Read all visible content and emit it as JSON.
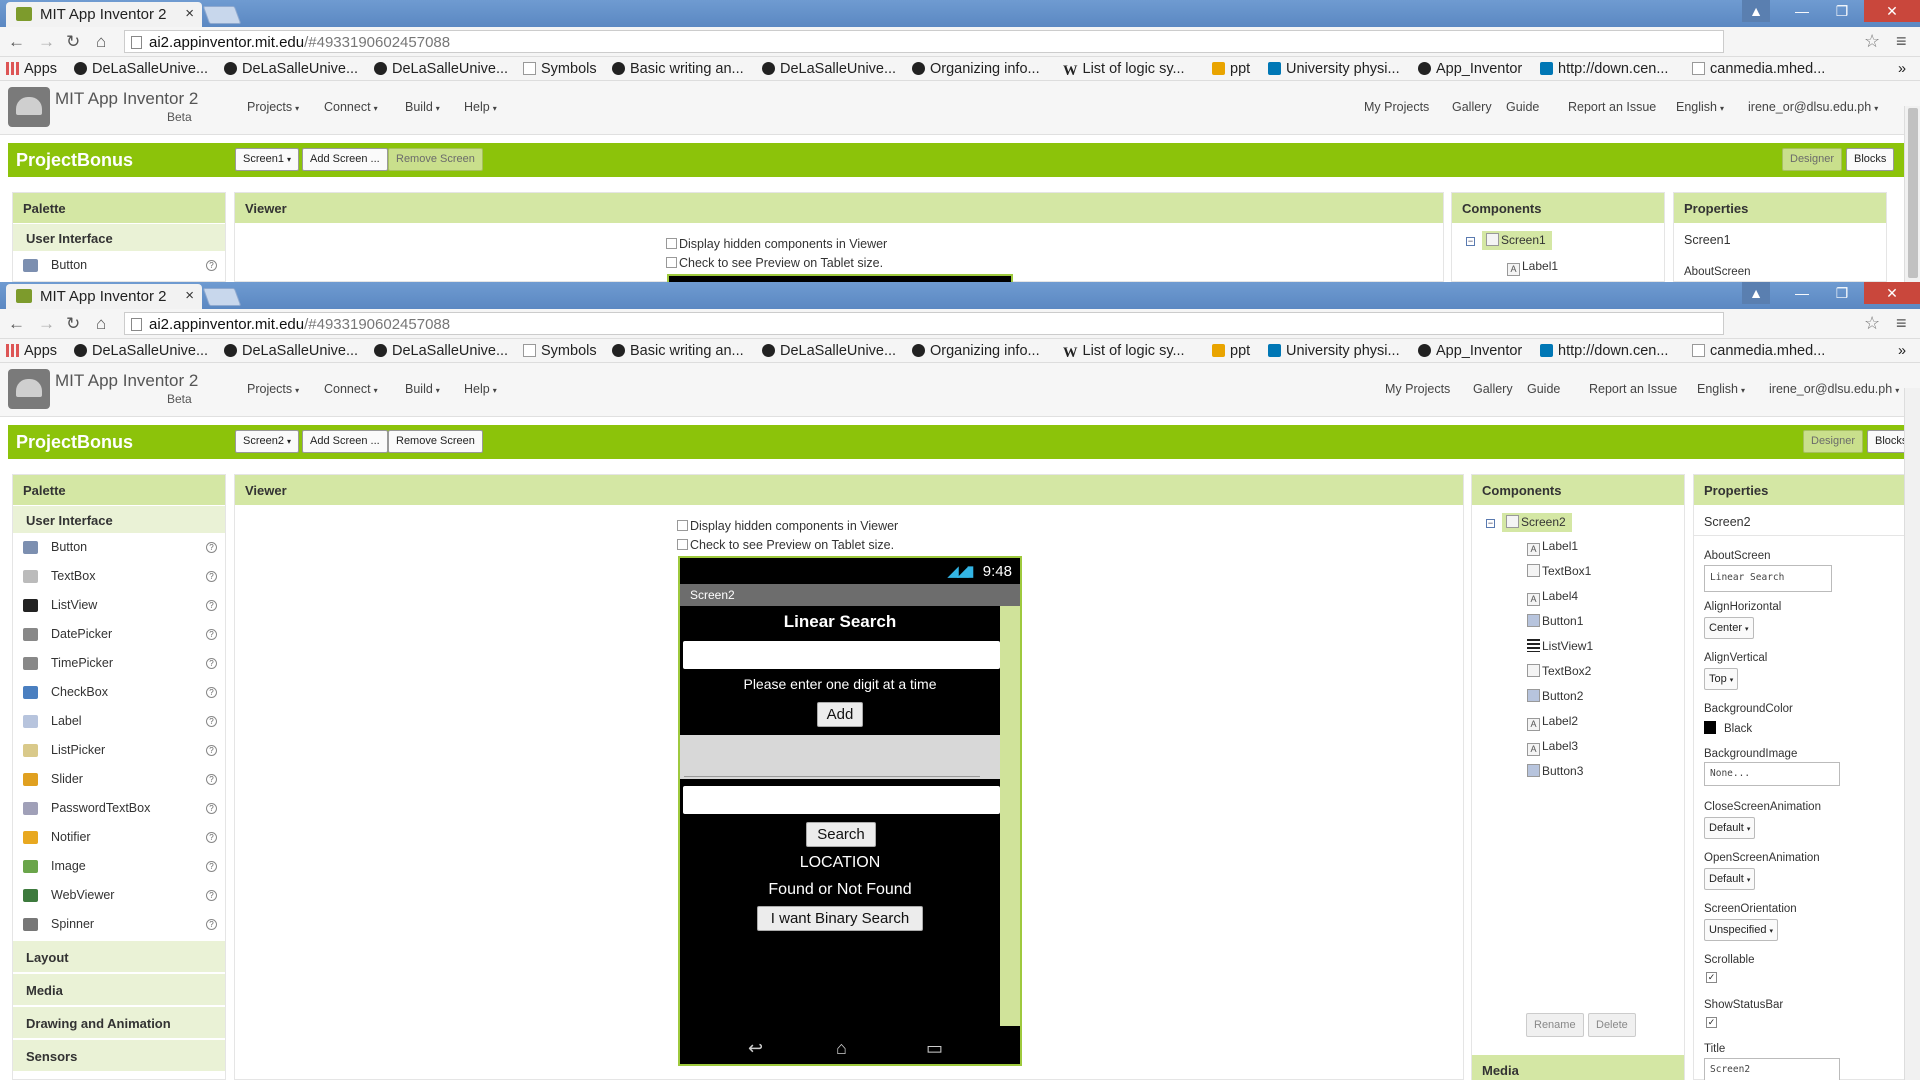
{
  "browser": {
    "tab_title": "MIT App Inventor 2",
    "tab_close": "×",
    "url_host": "ai2.appinventor.mit.edu",
    "url_path": "/#4933190602457088",
    "win_min": "—",
    "win_max": "❐",
    "win_close": "✕",
    "nav_back": "←",
    "nav_forward": "→",
    "nav_reload": "↻",
    "nav_home": "⌂",
    "star": "☆",
    "menu": "≡",
    "user_glyph": "▲",
    "more": "»"
  },
  "bookmarks": [
    {
      "label": "Apps",
      "icon": "apps-icon"
    },
    {
      "label": "DeLaSalleUnive...",
      "icon": "github-icon"
    },
    {
      "label": "DeLaSalleUnive...",
      "icon": "github-icon"
    },
    {
      "label": "DeLaSalleUnive...",
      "icon": "github-icon"
    },
    {
      "label": "Symbols",
      "icon": "symbols-icon"
    },
    {
      "label": "Basic writing an...",
      "icon": "github-icon"
    },
    {
      "label": "DeLaSalleUnive...",
      "icon": "github-icon"
    },
    {
      "label": "Organizing info...",
      "icon": "github-icon"
    },
    {
      "label": "List of logic sy...",
      "icon": "wikipedia-icon"
    },
    {
      "label": "ppt",
      "icon": "folder-icon"
    },
    {
      "label": "University physi...",
      "icon": "linkedin-icon"
    },
    {
      "label": "App_Inventor",
      "icon": "github-icon"
    },
    {
      "label": "http://down.cen...",
      "icon": "n-icon"
    },
    {
      "label": "canmedia.mhed...",
      "icon": "page-icon"
    }
  ],
  "ai": {
    "title": "MIT App Inventor 2",
    "beta": "Beta",
    "menus": [
      "Projects",
      "Connect",
      "Build",
      "Help"
    ],
    "right_links": [
      "My Projects",
      "Gallery",
      "Guide",
      "Report an Issue",
      "English",
      "irene_or@dlsu.edu.ph"
    ],
    "caret": "▾",
    "project_name": "ProjectBonus",
    "add_screen": "Add Screen ...",
    "remove_screen": "Remove Screen",
    "designer": "Designer",
    "blocks": "Blocks",
    "palette": "Palette",
    "user_interface": "User Interface",
    "viewer": "Viewer",
    "components": "Components",
    "properties": "Properties",
    "display_hidden": "Display hidden components in Viewer",
    "tablet_preview": "Check to see Preview on Tablet size.",
    "help_glyph": "?",
    "collapse_glyph": "⊟",
    "label_glyph": "A"
  },
  "window1": {
    "screen_select": "Screen1",
    "palette_items": [
      "Button"
    ],
    "tree_root": "Screen1",
    "tree_children": [
      "Label1"
    ],
    "props_screen": "Screen1",
    "props_first": "AboutScreen"
  },
  "window2": {
    "screen_select": "Screen2",
    "palette_items": [
      {
        "label": "Button",
        "icon": "button-icon"
      },
      {
        "label": "TextBox",
        "icon": "textbox-icon"
      },
      {
        "label": "ListView",
        "icon": "listview-icon"
      },
      {
        "label": "DatePicker",
        "icon": "datepicker-icon"
      },
      {
        "label": "TimePicker",
        "icon": "timepicker-icon"
      },
      {
        "label": "CheckBox",
        "icon": "checkbox-icon"
      },
      {
        "label": "Label",
        "icon": "label-icon"
      },
      {
        "label": "ListPicker",
        "icon": "listpicker-icon"
      },
      {
        "label": "Slider",
        "icon": "slider-icon"
      },
      {
        "label": "PasswordTextBox",
        "icon": "password-icon"
      },
      {
        "label": "Notifier",
        "icon": "notifier-icon"
      },
      {
        "label": "Image",
        "icon": "image-icon"
      },
      {
        "label": "WebViewer",
        "icon": "webviewer-icon"
      },
      {
        "label": "Spinner",
        "icon": "spinner-icon"
      }
    ],
    "categories": [
      "Layout",
      "Media",
      "Drawing and Animation",
      "Sensors"
    ],
    "phone": {
      "time": "9:48",
      "signal": "◢◢▮",
      "screen_title": "Screen2",
      "heading": "Linear Search",
      "instruction": "Please enter one digit at a time",
      "add_button": "Add",
      "search_button": "Search",
      "location": "LOCATION",
      "found": "Found or Not Found",
      "binary_button": "I want Binary Search",
      "nav_back": "↩",
      "nav_home": "⌂",
      "nav_recent": "▭"
    },
    "tree_root": "Screen2",
    "tree_children": [
      {
        "label": "Label1",
        "icon": "label-icon"
      },
      {
        "label": "TextBox1",
        "icon": "textbox-icon"
      },
      {
        "label": "Label4",
        "icon": "label-icon"
      },
      {
        "label": "Button1",
        "icon": "button-icon"
      },
      {
        "label": "ListView1",
        "icon": "listview-icon"
      },
      {
        "label": "TextBox2",
        "icon": "textbox-icon"
      },
      {
        "label": "Button2",
        "icon": "button-icon"
      },
      {
        "label": "Label2",
        "icon": "label-icon"
      },
      {
        "label": "Label3",
        "icon": "label-icon"
      },
      {
        "label": "Button3",
        "icon": "button-icon"
      }
    ],
    "rename": "Rename",
    "delete": "Delete",
    "media": "Media",
    "props": {
      "screen": "Screen2",
      "about_label": "AboutScreen",
      "about_value": "Linear Search",
      "alignh_label": "AlignHorizontal",
      "alignh_value": "Center",
      "alignv_label": "AlignVertical",
      "alignv_value": "Top",
      "bg_label": "BackgroundColor",
      "bg_value": "Black",
      "bg_color": "#000000",
      "bgimg_label": "BackgroundImage",
      "bgimg_value": "None...",
      "close_anim_label": "CloseScreenAnimation",
      "close_anim_value": "Default",
      "open_anim_label": "OpenScreenAnimation",
      "open_anim_value": "Default",
      "orient_label": "ScreenOrientation",
      "orient_value": "Unspecified",
      "scrollable_label": "Scrollable",
      "scrollable_checked": "✓",
      "statusbar_label": "ShowStatusBar",
      "statusbar_checked": "✓",
      "title_label": "Title",
      "title_value": "Screen2"
    }
  },
  "colors": {
    "accent_green": "#8cc30a",
    "panel_header": "#d4e7a4",
    "chrome_blue": "#5b88c2",
    "close_red": "#c9473c"
  }
}
